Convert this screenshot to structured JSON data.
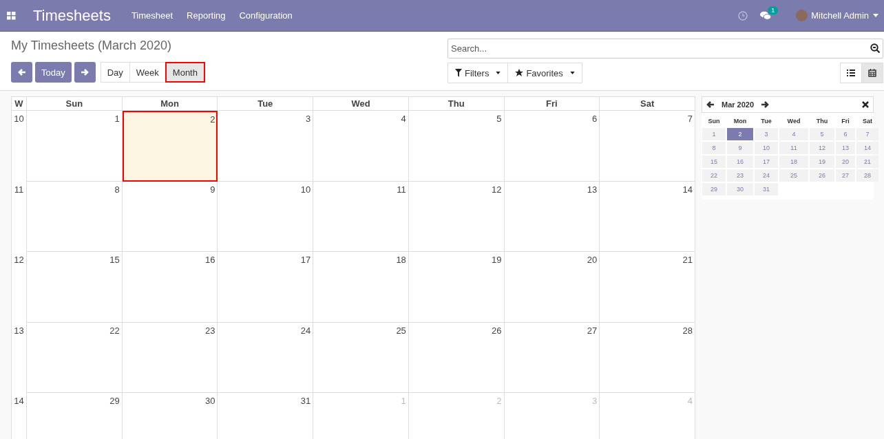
{
  "navbar": {
    "app_title": "Timesheets",
    "menu": [
      "Timesheet",
      "Reporting",
      "Configuration"
    ],
    "messages_badge": "1",
    "user": "Mitchell Admin"
  },
  "control_panel": {
    "title": "My Timesheets (March 2020)",
    "search": {
      "placeholder": "Search..."
    },
    "today_button": "Today",
    "scales": [
      {
        "label": "Day",
        "selected": false,
        "highlighted": false
      },
      {
        "label": "Week",
        "selected": false,
        "highlighted": false
      },
      {
        "label": "Month",
        "selected": true,
        "highlighted": true
      }
    ],
    "filters": [
      "Filters",
      "Favorites"
    ],
    "views": [
      {
        "kind": "list",
        "selected": false
      },
      {
        "kind": "calendar",
        "selected": true
      }
    ]
  },
  "calendar": {
    "week_header": "W",
    "day_headers": [
      "Sun",
      "Mon",
      "Tue",
      "Wed",
      "Thu",
      "Fri",
      "Sat"
    ],
    "weeks": [
      {
        "week": "10",
        "days": [
          {
            "label": "1",
            "other_month": false,
            "today": false,
            "highlighted": false
          },
          {
            "label": "2",
            "other_month": false,
            "today": true,
            "highlighted": true
          },
          {
            "label": "3",
            "other_month": false,
            "today": false,
            "highlighted": false
          },
          {
            "label": "4",
            "other_month": false,
            "today": false,
            "highlighted": false
          },
          {
            "label": "5",
            "other_month": false,
            "today": false,
            "highlighted": false
          },
          {
            "label": "6",
            "other_month": false,
            "today": false,
            "highlighted": false
          },
          {
            "label": "7",
            "other_month": false,
            "today": false,
            "highlighted": false
          }
        ]
      },
      {
        "week": "11",
        "days": [
          {
            "label": "8",
            "other_month": false,
            "today": false,
            "highlighted": false
          },
          {
            "label": "9",
            "other_month": false,
            "today": false,
            "highlighted": false
          },
          {
            "label": "10",
            "other_month": false,
            "today": false,
            "highlighted": false
          },
          {
            "label": "11",
            "other_month": false,
            "today": false,
            "highlighted": false
          },
          {
            "label": "12",
            "other_month": false,
            "today": false,
            "highlighted": false
          },
          {
            "label": "13",
            "other_month": false,
            "today": false,
            "highlighted": false
          },
          {
            "label": "14",
            "other_month": false,
            "today": false,
            "highlighted": false
          }
        ]
      },
      {
        "week": "12",
        "days": [
          {
            "label": "15",
            "other_month": false,
            "today": false,
            "highlighted": false
          },
          {
            "label": "16",
            "other_month": false,
            "today": false,
            "highlighted": false
          },
          {
            "label": "17",
            "other_month": false,
            "today": false,
            "highlighted": false
          },
          {
            "label": "18",
            "other_month": false,
            "today": false,
            "highlighted": false
          },
          {
            "label": "19",
            "other_month": false,
            "today": false,
            "highlighted": false
          },
          {
            "label": "20",
            "other_month": false,
            "today": false,
            "highlighted": false
          },
          {
            "label": "21",
            "other_month": false,
            "today": false,
            "highlighted": false
          }
        ]
      },
      {
        "week": "13",
        "days": [
          {
            "label": "22",
            "other_month": false,
            "today": false,
            "highlighted": false
          },
          {
            "label": "23",
            "other_month": false,
            "today": false,
            "highlighted": false
          },
          {
            "label": "24",
            "other_month": false,
            "today": false,
            "highlighted": false
          },
          {
            "label": "25",
            "other_month": false,
            "today": false,
            "highlighted": false
          },
          {
            "label": "26",
            "other_month": false,
            "today": false,
            "highlighted": false
          },
          {
            "label": "27",
            "other_month": false,
            "today": false,
            "highlighted": false
          },
          {
            "label": "28",
            "other_month": false,
            "today": false,
            "highlighted": false
          }
        ]
      },
      {
        "week": "14",
        "days": [
          {
            "label": "29",
            "other_month": false,
            "today": false,
            "highlighted": false
          },
          {
            "label": "30",
            "other_month": false,
            "today": false,
            "highlighted": false
          },
          {
            "label": "31",
            "other_month": false,
            "today": false,
            "highlighted": false
          },
          {
            "label": "1",
            "other_month": true,
            "today": false,
            "highlighted": false
          },
          {
            "label": "2",
            "other_month": true,
            "today": false,
            "highlighted": false
          },
          {
            "label": "3",
            "other_month": true,
            "today": false,
            "highlighted": false
          },
          {
            "label": "4",
            "other_month": true,
            "today": false,
            "highlighted": false
          }
        ]
      }
    ]
  },
  "mini_calendar": {
    "title": "Mar 2020",
    "day_headers": [
      "Sun",
      "Mon",
      "Tue",
      "Wed",
      "Thu",
      "Fri",
      "Sat"
    ],
    "days": [
      {
        "label": "1",
        "selected": false
      },
      {
        "label": "2",
        "selected": true
      },
      {
        "label": "3",
        "selected": false
      },
      {
        "label": "4",
        "selected": false
      },
      {
        "label": "5",
        "selected": false
      },
      {
        "label": "6",
        "selected": false
      },
      {
        "label": "7",
        "selected": false
      },
      {
        "label": "8",
        "selected": false
      },
      {
        "label": "9",
        "selected": false
      },
      {
        "label": "10",
        "selected": false
      },
      {
        "label": "11",
        "selected": false
      },
      {
        "label": "12",
        "selected": false
      },
      {
        "label": "13",
        "selected": false
      },
      {
        "label": "14",
        "selected": false
      },
      {
        "label": "15",
        "selected": false
      },
      {
        "label": "16",
        "selected": false
      },
      {
        "label": "17",
        "selected": false
      },
      {
        "label": "18",
        "selected": false
      },
      {
        "label": "19",
        "selected": false
      },
      {
        "label": "20",
        "selected": false
      },
      {
        "label": "21",
        "selected": false
      },
      {
        "label": "22",
        "selected": false
      },
      {
        "label": "23",
        "selected": false
      },
      {
        "label": "24",
        "selected": false
      },
      {
        "label": "25",
        "selected": false
      },
      {
        "label": "26",
        "selected": false
      },
      {
        "label": "27",
        "selected": false
      },
      {
        "label": "28",
        "selected": false
      },
      {
        "label": "29",
        "selected": false
      },
      {
        "label": "30",
        "selected": false
      },
      {
        "label": "31",
        "selected": false
      }
    ]
  }
}
